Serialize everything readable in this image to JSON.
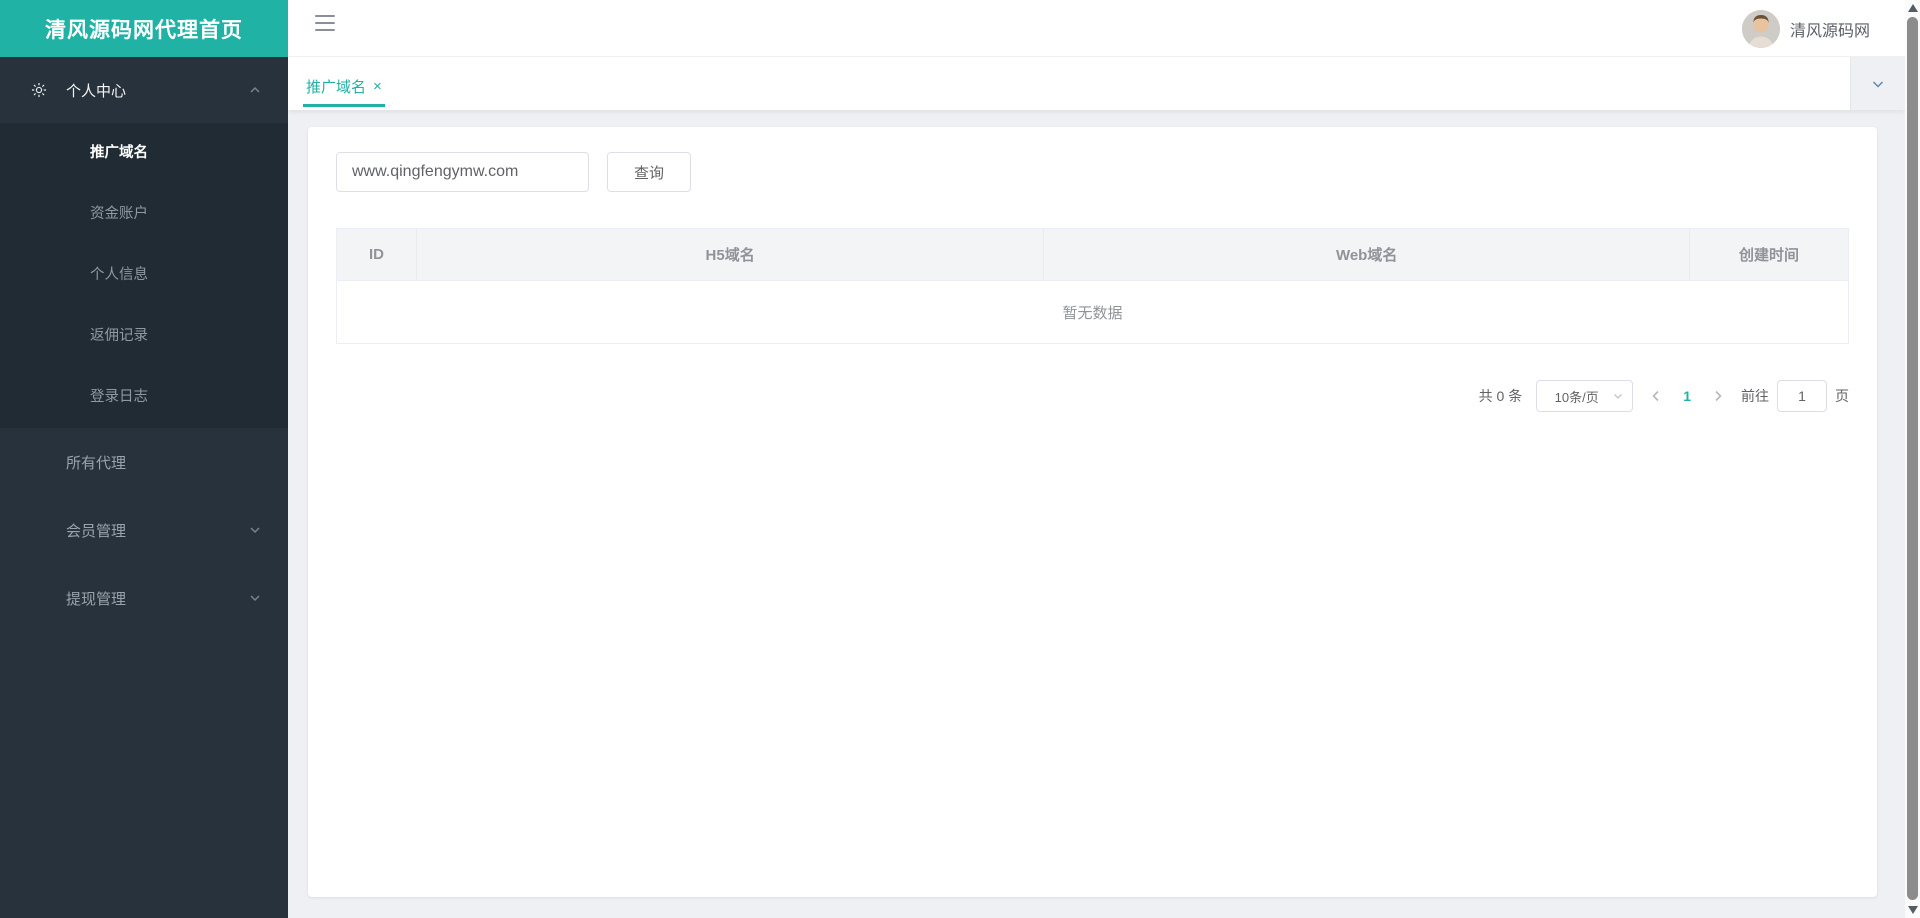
{
  "app": {
    "logo_title": "清风源码网代理首页"
  },
  "header": {
    "username": "清风源码网"
  },
  "sidebar": {
    "personal_center": {
      "label": "个人中心"
    },
    "submenu": [
      {
        "label": "推广域名",
        "active": true
      },
      {
        "label": "资金账户",
        "active": false
      },
      {
        "label": "个人信息",
        "active": false
      },
      {
        "label": "返佣记录",
        "active": false
      },
      {
        "label": "登录日志",
        "active": false
      }
    ],
    "items": [
      {
        "label": "所有代理"
      },
      {
        "label": "会员管理"
      },
      {
        "label": "提现管理"
      }
    ]
  },
  "tabbar": {
    "active_tab": "推广域名",
    "close_label": "×"
  },
  "toolbar": {
    "search_value": "www.qingfengymw.com",
    "search_button": "查询"
  },
  "table": {
    "columns": [
      "ID",
      "H5域名",
      "Web域名",
      "创建时间"
    ],
    "rows": [],
    "empty_text": "暂无数据"
  },
  "pagination": {
    "total": "共 0 条",
    "page_size": "10条/页",
    "current_page": "1",
    "goto_prefix": "前往",
    "goto_value": "1",
    "goto_suffix": "页"
  },
  "colors": {
    "accent": "#21b2a6",
    "sidebar_bg": "#28323c",
    "submenu_bg": "#212b33"
  }
}
